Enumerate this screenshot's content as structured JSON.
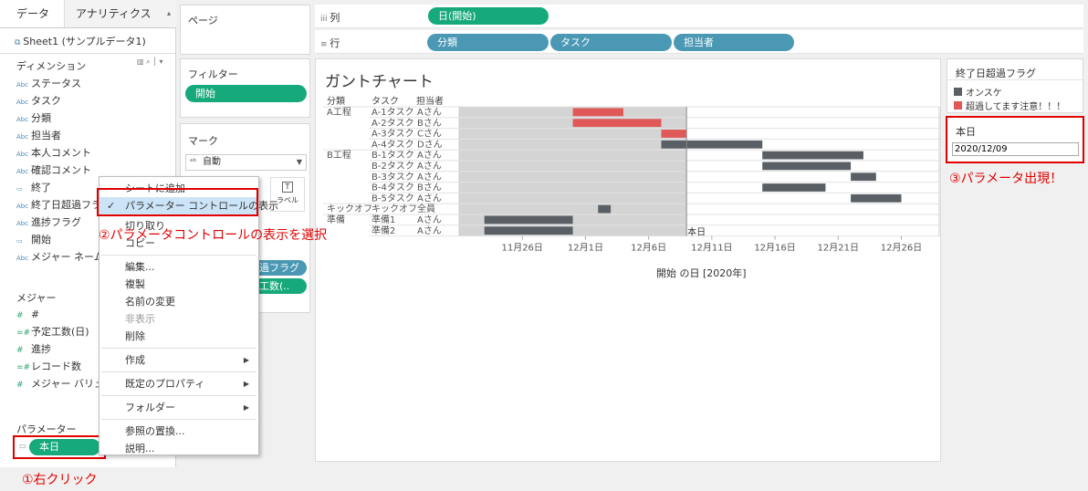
{
  "left": {
    "tabs": [
      "データ",
      "アナリティクス"
    ],
    "sheet": "Sheet1 (サンプルデータ1)",
    "dimensions_title": "ディメンション",
    "dimensions": [
      {
        "label": "ステータス",
        "icon": "Abc"
      },
      {
        "label": "タスク",
        "icon": "Abc"
      },
      {
        "label": "分類",
        "icon": "Abc"
      },
      {
        "label": "担当者",
        "icon": "Abc"
      },
      {
        "label": "本人コメント",
        "icon": "Abc"
      },
      {
        "label": "確認コメント",
        "icon": "Abc"
      },
      {
        "label": "終了",
        "icon": "cal"
      },
      {
        "label": "終了日超過フラグ",
        "icon": "Abc"
      },
      {
        "label": "進捗フラグ",
        "icon": "Abc"
      },
      {
        "label": "開始",
        "icon": "cal"
      },
      {
        "label": "メジャー ネーム",
        "icon": "Abc"
      }
    ],
    "measures_title": "メジャー",
    "measures": [
      {
        "label": "#",
        "icon": "#"
      },
      {
        "label": "予定工数(日)",
        "icon": "=#"
      },
      {
        "label": "進捗",
        "icon": "#"
      },
      {
        "label": "レコード数",
        "icon": "=#"
      },
      {
        "label": "メジャー バリュー",
        "icon": "#"
      }
    ],
    "parameters_title": "パラメーター",
    "parameter": "本日"
  },
  "annotations": {
    "step1": "①右クリック",
    "step2": "②パラメータコントロールの表示を選択",
    "step3": "③パラメータ出現！"
  },
  "pages": {
    "title": "ページ"
  },
  "filters": {
    "title": "フィルター",
    "pill": "開始"
  },
  "marks": {
    "title": "マーク",
    "type": "自動",
    "label_button": "ラベル",
    "pill1": "過フラグ",
    "pill2": "工数(..",
    "label_icon": "T"
  },
  "shelves": {
    "columns_label": "列",
    "rows_label": "行",
    "columns_pill": "日(開始)",
    "rows_pills": [
      "分類",
      "タスク",
      "担当者"
    ]
  },
  "chart_data": {
    "type": "gantt",
    "title": "ガントチャート",
    "headers": [
      "分類",
      "タスク",
      "担当者"
    ],
    "xlabel": "開始 の日 [2020年]",
    "x_ticks": [
      "11月26日",
      "12月1日",
      "12月6日",
      "12月11日",
      "12月16日",
      "12月21日",
      "12月26日"
    ],
    "x_range": [
      "2020-11-21",
      "2020-12-29"
    ],
    "reference_line": {
      "date": "2020-12-09",
      "label": "本日"
    },
    "shaded_range": [
      "2020-11-21",
      "2020-12-09"
    ],
    "rows": [
      {
        "group": "A工程",
        "task": "A-1タスク",
        "owner": "Aさん",
        "start": "2020-11-30",
        "end": "2020-12-04",
        "flag": "超過してます注意！！！"
      },
      {
        "group": "",
        "task": "A-2タスク",
        "owner": "Bさん",
        "start": "2020-11-30",
        "end": "2020-12-07",
        "flag": "超過してます注意！！！"
      },
      {
        "group": "",
        "task": "A-3タスク",
        "owner": "Cさん",
        "start": "2020-12-07",
        "end": "2020-12-09",
        "flag": "超過してます注意！！！"
      },
      {
        "group": "",
        "task": "A-4タスク",
        "owner": "Dさん",
        "start": "2020-12-07",
        "end": "2020-12-15",
        "flag": "オンスケ"
      },
      {
        "group": "B工程",
        "task": "B-1タスク",
        "owner": "Aさん",
        "start": "2020-12-15",
        "end": "2020-12-23",
        "flag": "オンスケ"
      },
      {
        "group": "",
        "task": "B-2タスク",
        "owner": "Aさん",
        "start": "2020-12-15",
        "end": "2020-12-22",
        "flag": "オンスケ"
      },
      {
        "group": "",
        "task": "B-3タスク",
        "owner": "Aさん",
        "start": "2020-12-22",
        "end": "2020-12-24",
        "flag": "オンスケ"
      },
      {
        "group": "",
        "task": "B-4タスク",
        "owner": "Bさん",
        "start": "2020-12-15",
        "end": "2020-12-20",
        "flag": "オンスケ"
      },
      {
        "group": "",
        "task": "B-5タスク",
        "owner": "Aさん",
        "start": "2020-12-22",
        "end": "2020-12-26",
        "flag": "オンスケ"
      },
      {
        "group": "キックオフ",
        "task": "キックオフ",
        "owner": "全員",
        "start": "2020-12-02",
        "end": "2020-12-03",
        "flag": "オンスケ"
      },
      {
        "group": "準備",
        "task": "準備1",
        "owner": "Aさん",
        "start": "2020-11-23",
        "end": "2020-11-30",
        "flag": "オンスケ"
      },
      {
        "group": "",
        "task": "準備2",
        "owner": "Aさん",
        "start": "2020-11-23",
        "end": "2020-11-30",
        "flag": "オンスケ"
      }
    ],
    "colors": {
      "オンスケ": "#5a5f66",
      "超過してます注意！！！": "#e05858"
    }
  },
  "legend": {
    "title": "終了日超過フラグ",
    "items": [
      {
        "label": "オンスケ",
        "color": "#5a5f66"
      },
      {
        "label": "超過してます注意！！！",
        "color": "#e05858"
      }
    ]
  },
  "param_control": {
    "title": "本日",
    "value": "2020/12/09"
  },
  "context_menu": {
    "items": [
      {
        "label": "シートに追加",
        "type": "item"
      },
      {
        "label": "パラメーター コントロールの表示",
        "type": "checked"
      },
      {
        "label": "切り取り",
        "type": "item"
      },
      {
        "label": "コピー",
        "type": "item"
      },
      {
        "type": "sep"
      },
      {
        "label": "編集...",
        "type": "item"
      },
      {
        "label": "複製",
        "type": "item"
      },
      {
        "label": "名前の変更",
        "type": "item"
      },
      {
        "label": "非表示",
        "type": "disabled"
      },
      {
        "label": "削除",
        "type": "item"
      },
      {
        "type": "sep"
      },
      {
        "label": "作成",
        "type": "sub"
      },
      {
        "type": "sep"
      },
      {
        "label": "既定のプロパティ",
        "type": "sub"
      },
      {
        "type": "sep"
      },
      {
        "label": "フォルダー",
        "type": "sub"
      },
      {
        "type": "sep"
      },
      {
        "label": "参照の置換...",
        "type": "item"
      },
      {
        "label": "説明...",
        "type": "item"
      }
    ]
  }
}
